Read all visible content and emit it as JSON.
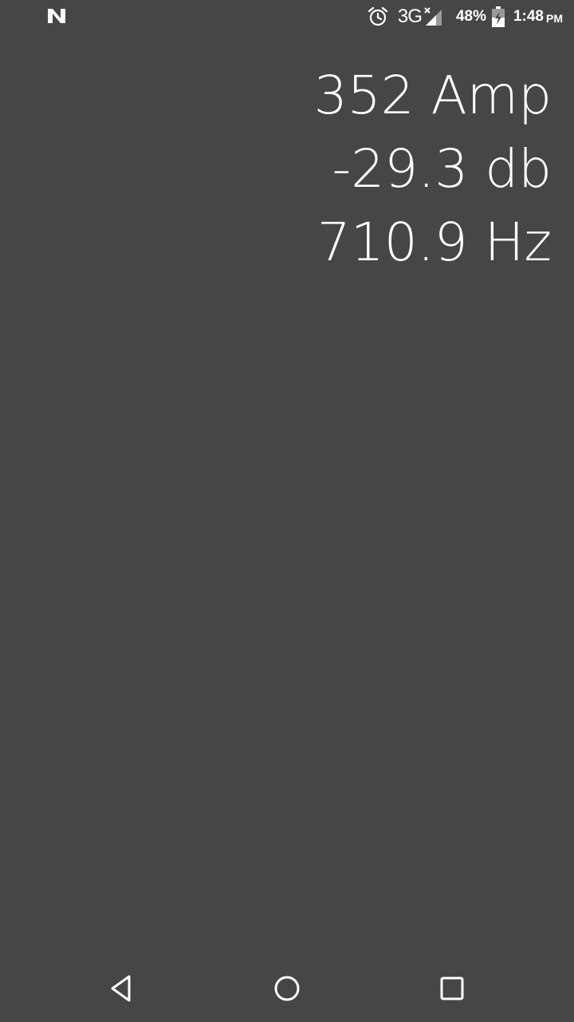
{
  "status_bar": {
    "notification_icon": "n-logo-icon",
    "alarm_icon": "alarm-clock-icon",
    "network_type": "3G",
    "signal_icon": "signal-no-data-icon",
    "battery_percent": "48%",
    "battery_icon": "battery-charging-icon",
    "time": "1:48",
    "time_suffix": "PM"
  },
  "readouts": {
    "amplitude": "352 Amp",
    "decibels": "-29.3 db",
    "frequency": "710.9 Hz"
  },
  "nav_bar": {
    "back_icon": "back-triangle-icon",
    "home_icon": "home-circle-icon",
    "recents_icon": "recents-square-icon"
  },
  "colors": {
    "background": "#464646",
    "foreground": "#ffffff"
  }
}
